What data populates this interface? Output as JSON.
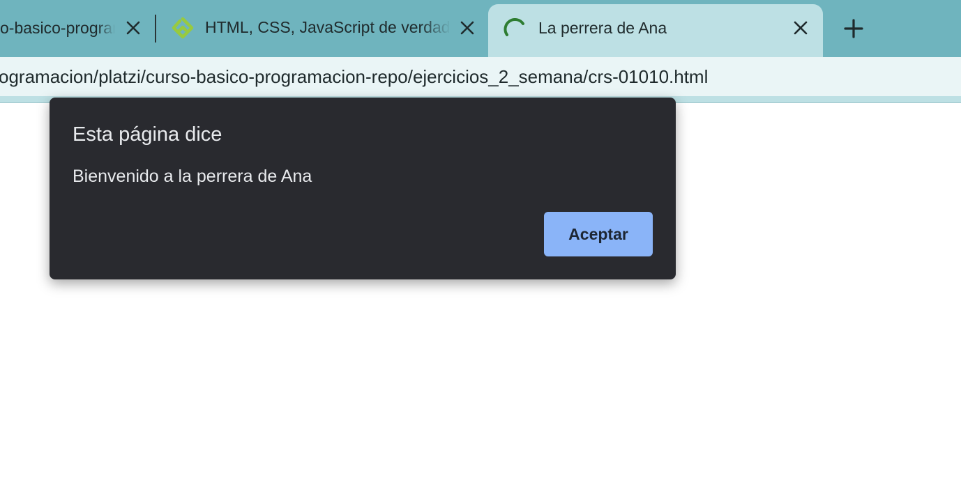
{
  "browser": {
    "tabs": [
      {
        "title": "o-basico-programacion-repo",
        "favicon": "page-icon",
        "active": false
      },
      {
        "title": "HTML, CSS, JavaScript de verdad",
        "favicon": "platzi-logo-icon",
        "active": false
      },
      {
        "title": "La perrera de Ana",
        "favicon": "loading-spinner-icon",
        "active": true
      }
    ],
    "new_tab_icon": "plus-icon",
    "url": "ogramacion/platzi/curso-basico-programacion-repo/ejercicios_2_semana/crs-01010.html"
  },
  "dialog": {
    "heading": "Esta página dice",
    "message": "Bienvenido a la perrera de Ana",
    "ok_label": "Aceptar"
  },
  "colors": {
    "tabstrip": "#6fb4be",
    "active_tab": "#bde0e4",
    "dialog_bg": "#292a2f",
    "button_bg": "#8ab4f8",
    "spinner": "#2e7d32",
    "platzi_logo": "#98ca3f"
  }
}
